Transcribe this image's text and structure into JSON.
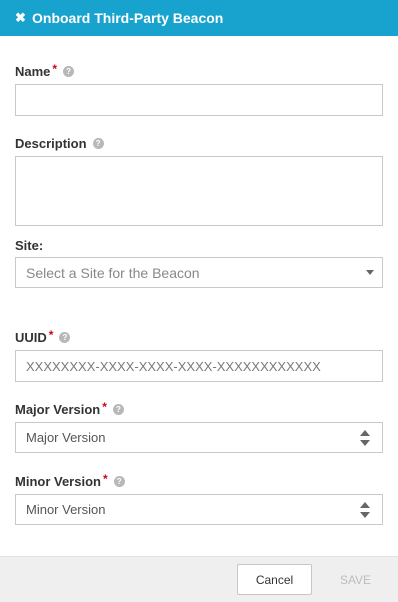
{
  "header": {
    "close_glyph": "✖",
    "title": "Onboard Third-Party Beacon",
    "background_color": "#18a3cf"
  },
  "fields": {
    "name": {
      "label": "Name",
      "required_mark": "*",
      "help": "?",
      "value": ""
    },
    "description": {
      "label": "Description",
      "help": "?",
      "value": ""
    },
    "site": {
      "label": "Site:",
      "placeholder": "Select a Site for the Beacon"
    },
    "uuid": {
      "label": "UUID",
      "required_mark": "*",
      "help": "?",
      "placeholder": "XXXXXXXX-XXXX-XXXX-XXXX-XXXXXXXXXXXX"
    },
    "major_version": {
      "label": "Major Version",
      "required_mark": "*",
      "help": "?",
      "placeholder": "Major Version"
    },
    "minor_version": {
      "label": "Minor Version",
      "required_mark": "*",
      "help": "?",
      "placeholder": "Minor Version"
    }
  },
  "footer": {
    "cancel_label": "Cancel",
    "save_label": "SAVE"
  }
}
